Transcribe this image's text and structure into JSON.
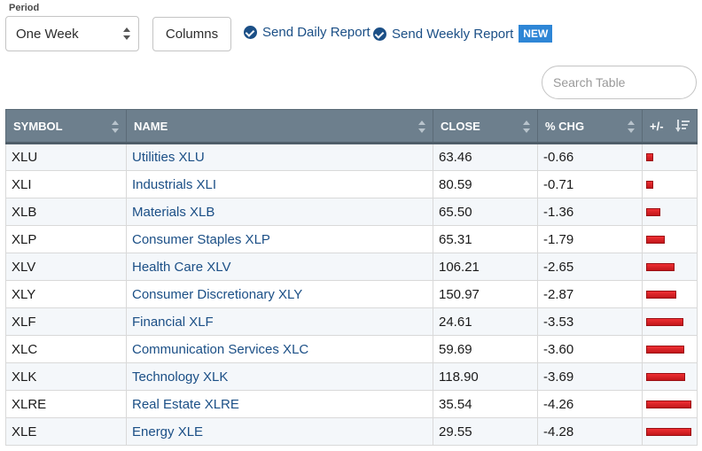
{
  "toolbar": {
    "period_label": "Period",
    "period_value": "One Week",
    "columns_label": "Columns",
    "daily_report_label": "Send Daily Report",
    "weekly_report_label": "Send Weekly Report",
    "new_badge": "NEW",
    "accent_color": "#1b4f86",
    "badge_color": "#2e86d6"
  },
  "search": {
    "placeholder": "Search Table",
    "value": ""
  },
  "table": {
    "headers": {
      "symbol": "SYMBOL",
      "name": "NAME",
      "close": "CLOSE",
      "pct_chg": "% CHG",
      "plus_minus": "+/-"
    },
    "bar_color": "#d9202a",
    "bar_max_pct": 4.28,
    "rows": [
      {
        "symbol": "XLU",
        "name": "Utilities XLU",
        "close": "63.46",
        "pct_chg": "-0.66",
        "pct_value": -0.66
      },
      {
        "symbol": "XLI",
        "name": "Industrials XLI",
        "close": "80.59",
        "pct_chg": "-0.71",
        "pct_value": -0.71
      },
      {
        "symbol": "XLB",
        "name": "Materials XLB",
        "close": "65.50",
        "pct_chg": "-1.36",
        "pct_value": -1.36
      },
      {
        "symbol": "XLP",
        "name": "Consumer Staples XLP",
        "close": "65.31",
        "pct_chg": "-1.79",
        "pct_value": -1.79
      },
      {
        "symbol": "XLV",
        "name": "Health Care XLV",
        "close": "106.21",
        "pct_chg": "-2.65",
        "pct_value": -2.65
      },
      {
        "symbol": "XLY",
        "name": "Consumer Discretionary XLY",
        "close": "150.97",
        "pct_chg": "-2.87",
        "pct_value": -2.87
      },
      {
        "symbol": "XLF",
        "name": "Financial XLF",
        "close": "24.61",
        "pct_chg": "-3.53",
        "pct_value": -3.53
      },
      {
        "symbol": "XLC",
        "name": "Communication Services XLC",
        "close": "59.69",
        "pct_chg": "-3.60",
        "pct_value": -3.6
      },
      {
        "symbol": "XLK",
        "name": "Technology XLK",
        "close": "118.90",
        "pct_chg": "-3.69",
        "pct_value": -3.69
      },
      {
        "symbol": "XLRE",
        "name": "Real Estate XLRE",
        "close": "35.54",
        "pct_chg": "-4.26",
        "pct_value": -4.26
      },
      {
        "symbol": "XLE",
        "name": "Energy XLE",
        "close": "29.55",
        "pct_chg": "-4.28",
        "pct_value": -4.28
      }
    ]
  }
}
